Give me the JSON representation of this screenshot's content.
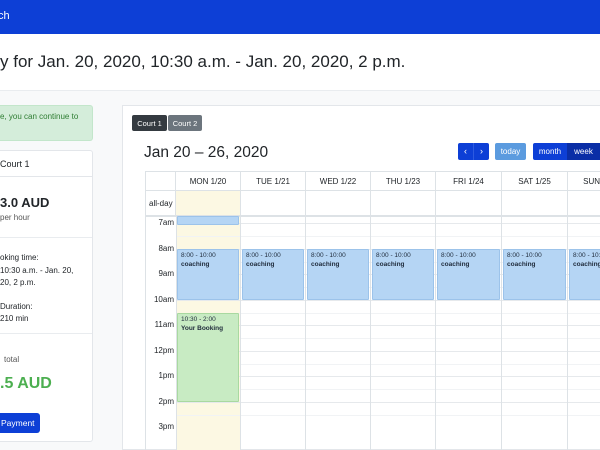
{
  "navbar": {
    "brand": "ch",
    "color": "#0d3fd6"
  },
  "page": {
    "title": "y for Jan. 20, 2020, 10:30 a.m. - Jan. 20, 2020, 2 p.m."
  },
  "alert": {
    "text": "e, you can continue to"
  },
  "booking": {
    "court": "Court 1",
    "price": "3.0 AUD",
    "per": "per hour",
    "time_label": "oking time:",
    "time_lines": [
      "10:30 a.m. - Jan. 20,",
      "20, 2 p.m."
    ],
    "duration_label": "Duration:",
    "duration_value": "210 min",
    "total_label": "total",
    "total_value": ".5 AUD",
    "pay_button": "Payment"
  },
  "calendar": {
    "courts": [
      "Court 1",
      "Court 2"
    ],
    "range_title": "Jan 20 – 26, 2020",
    "nav": {
      "prev": "‹",
      "next": "›",
      "today": "today"
    },
    "views": [
      "month",
      "week"
    ],
    "allday_label": "all-day",
    "days": [
      "MON 1/20",
      "TUE 1/21",
      "WED 1/22",
      "THU 1/23",
      "FRI 1/24",
      "SAT 1/25",
      "SUN 1/26"
    ],
    "times": [
      "7am",
      "8am",
      "9am",
      "10am",
      "11am",
      "12pm",
      "1pm",
      "2pm",
      "3pm"
    ],
    "events": [
      {
        "day": 0,
        "time": "",
        "name": "",
        "color": "blue"
      },
      {
        "day": 0,
        "time": "8:00 - 10:00",
        "name": "coaching",
        "color": "blue"
      },
      {
        "day": 1,
        "time": "8:00 - 10:00",
        "name": "coaching",
        "color": "blue"
      },
      {
        "day": 2,
        "time": "8:00 - 10:00",
        "name": "coaching",
        "color": "blue"
      },
      {
        "day": 3,
        "time": "8:00 - 10:00",
        "name": "coaching",
        "color": "blue"
      },
      {
        "day": 4,
        "time": "8:00 - 10:00",
        "name": "coaching",
        "color": "blue"
      },
      {
        "day": 5,
        "time": "8:00 - 10:00",
        "name": "coaching",
        "color": "blue"
      },
      {
        "day": 6,
        "time": "8:00 - 10:00",
        "name": "coaching",
        "color": "blue"
      },
      {
        "day": 0,
        "time": "10:30 - 2:00",
        "name": "Your Booking",
        "color": "green"
      }
    ]
  },
  "colors": {
    "primary": "#0d3fd6",
    "event_blue": "#b5d5f4",
    "event_green": "#c8ebc3",
    "today_bg": "#fcf8e3",
    "success": "#4caf50"
  }
}
